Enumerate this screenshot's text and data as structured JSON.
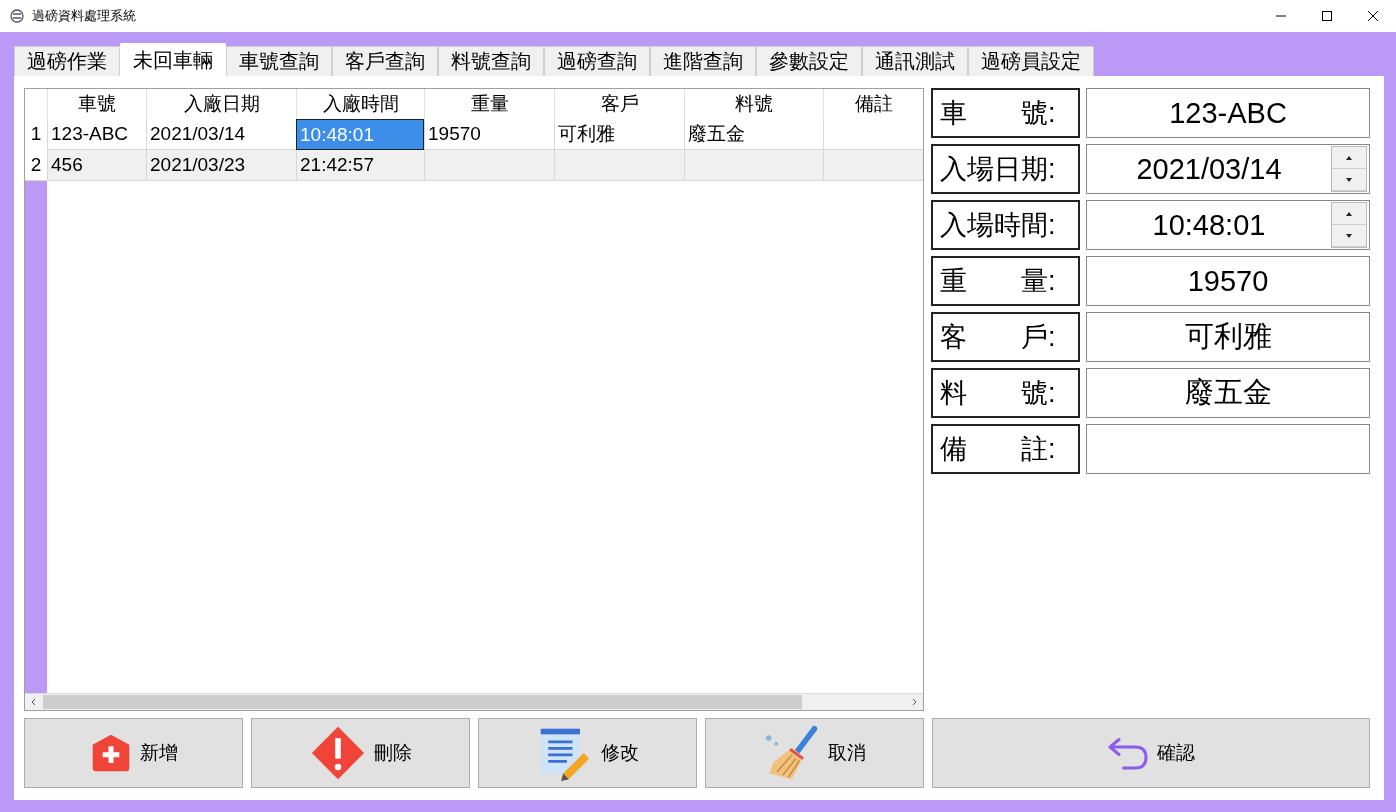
{
  "window": {
    "title": "過磅資料處理系統"
  },
  "tabs": [
    {
      "label": "過磅作業",
      "selected": false
    },
    {
      "label": "未回車輛",
      "selected": true
    },
    {
      "label": "車號查詢",
      "selected": false
    },
    {
      "label": "客戶查詢",
      "selected": false
    },
    {
      "label": "料號查詢",
      "selected": false
    },
    {
      "label": "過磅查詢",
      "selected": false
    },
    {
      "label": "進階查詢",
      "selected": false
    },
    {
      "label": "參數設定",
      "selected": false
    },
    {
      "label": "通訊測試",
      "selected": false
    },
    {
      "label": "過磅員設定",
      "selected": false
    }
  ],
  "table": {
    "columns": [
      "車號",
      "入廠日期",
      "入廠時間",
      "重量",
      "客戶",
      "料號",
      "備註"
    ],
    "rows": [
      {
        "number": "1",
        "cells": [
          {
            "text": "123-ABC",
            "selected": false
          },
          {
            "text": "2021/03/14",
            "selected": false
          },
          {
            "text": "10:48:01",
            "selected": true
          },
          {
            "text": "19570",
            "selected": false
          },
          {
            "text": "可利雅",
            "selected": false
          },
          {
            "text": "廢五金",
            "selected": false
          }
        ]
      },
      {
        "number": "2",
        "cells": [
          {
            "text": "456",
            "selected": false
          },
          {
            "text": "2021/03/23",
            "selected": false
          },
          {
            "text": "21:42:57",
            "selected": false
          }
        ]
      }
    ]
  },
  "form": [
    {
      "label": "車　　號:",
      "value": "123-ABC",
      "kind": "text"
    },
    {
      "label": "入場日期:",
      "value": "2021/03/14",
      "kind": "spin"
    },
    {
      "label": "入場時間:",
      "value": "10:48:01",
      "kind": "spin"
    },
    {
      "label": "重　　量:",
      "value": "19570",
      "kind": "text"
    },
    {
      "label": "客　　戶:",
      "value": "可利雅",
      "kind": "text"
    },
    {
      "label": "料　　號:",
      "value": "廢五金",
      "kind": "text"
    },
    {
      "label": "備　　註:",
      "kind": "text"
    }
  ],
  "buttons": [
    {
      "label": "新增",
      "kind": "add"
    },
    {
      "label": "刪除",
      "kind": "delete"
    },
    {
      "label": "修改",
      "kind": "edit"
    },
    {
      "label": "取消",
      "kind": "cancel"
    },
    {
      "label": "確認",
      "kind": "confirm"
    }
  ]
}
